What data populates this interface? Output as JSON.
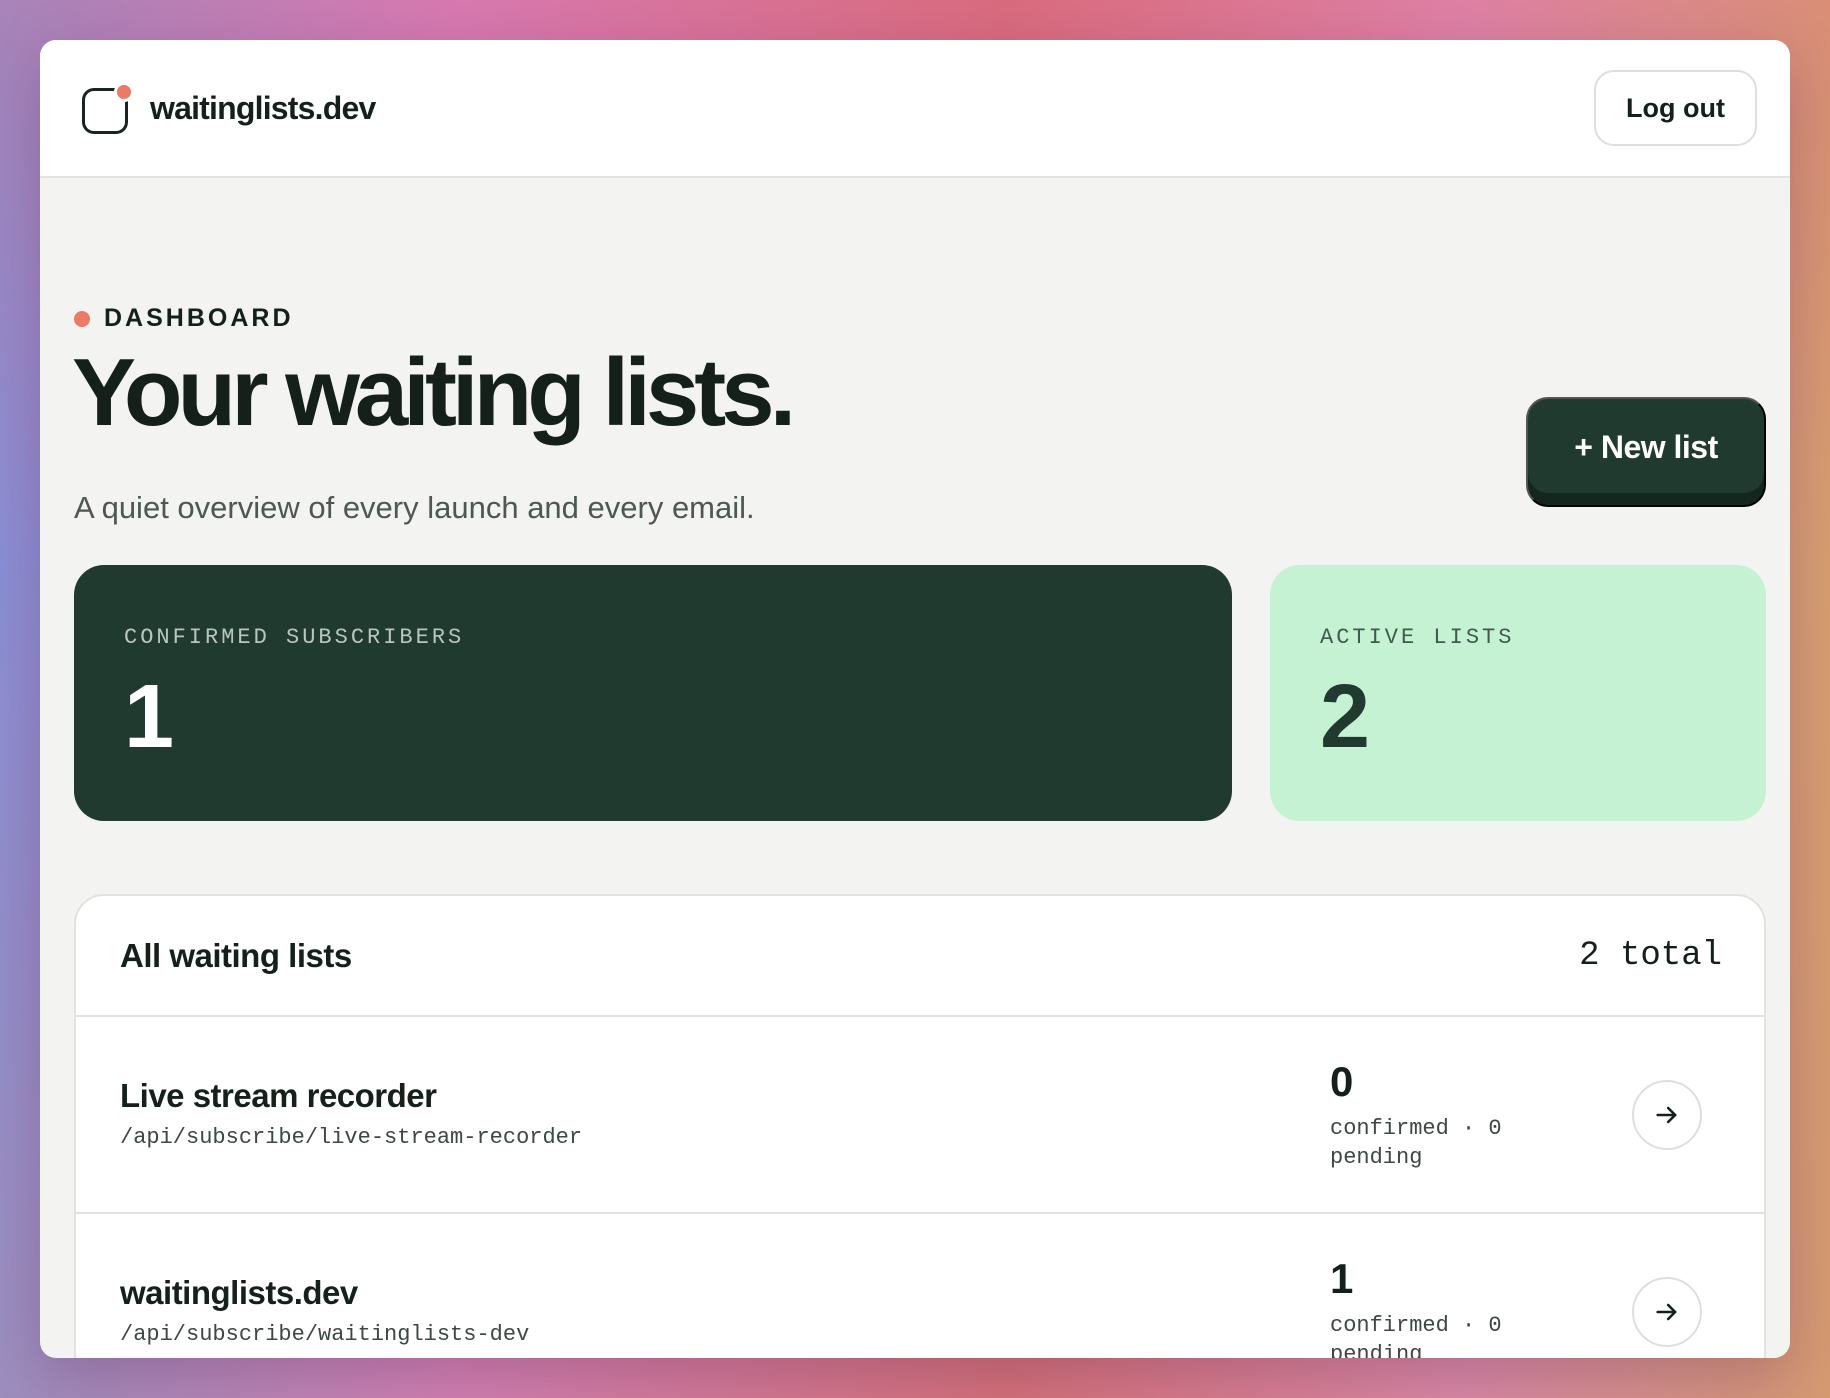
{
  "header": {
    "brand_name": "waitinglists.dev",
    "logout_label": "Log out"
  },
  "hero": {
    "eyebrow": "DASHBOARD",
    "title": "Your waiting lists.",
    "subtitle": "A quiet overview of every launch and every email.",
    "new_list_label": "+ New list"
  },
  "stats": {
    "confirmed_label": "CONFIRMED SUBSCRIBERS",
    "confirmed_value": "1",
    "active_label": "ACTIVE LISTS",
    "active_value": "2"
  },
  "lists": {
    "title": "All waiting lists",
    "count": "2 total",
    "items": [
      {
        "name": "Live stream recorder",
        "path": "/api/subscribe/live-stream-recorder",
        "confirmed": "0",
        "meta_line1": "confirmed · 0",
        "meta_line2": "pending"
      },
      {
        "name": "waitinglists.dev",
        "path": "/api/subscribe/waitinglists-dev",
        "confirmed": "1",
        "meta_line1": "confirmed · 0",
        "meta_line2": "pending"
      }
    ]
  },
  "colors": {
    "accent_dot": "#ec7a66",
    "dark_green": "#213a2f",
    "mint": "#c5f2d3"
  },
  "icons": [
    "logo-mark-icon",
    "arrow-right-icon"
  ]
}
